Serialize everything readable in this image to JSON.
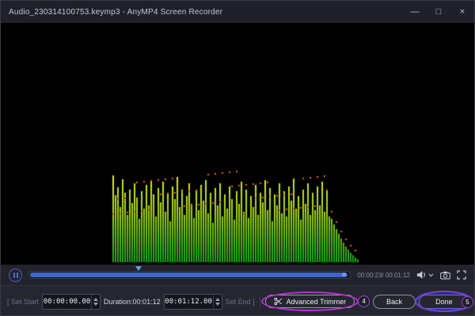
{
  "window": {
    "title": "Audio_230314100753.keymp3  -  AnyMP4 Screen Recorder",
    "controls": {
      "minimize": "—",
      "maximize": "□",
      "close": "×"
    }
  },
  "playback": {
    "time_display": "00:00:23/ 00:01:12",
    "progress_percent": 34,
    "fill_percent": 99
  },
  "toolbar": {
    "set_start_label": "[ Set Start",
    "start_time_value": "00:00:00.00",
    "duration_label": "Duration:00:01:12",
    "end_time_value": "00:01:12.00",
    "set_end_label": "Set End ]",
    "advanced_trimmer_label": "Advanced Trimmer",
    "back_label": "Back",
    "done_label": "Done"
  },
  "annotations": {
    "badge4": "4",
    "badge5": "5"
  },
  "colors": {
    "accent_blue": "#4263cf",
    "bar_green": "#17a317",
    "bar_mid": "#9ed414",
    "bar_yellow": "#f0f014",
    "peak_orange": "#e8680e",
    "annotation_magenta": "#bb2fd6",
    "annotation_purple": "#7b3de2"
  },
  "waveform": {
    "heights": [
      110,
      85,
      95,
      70,
      105,
      88,
      60,
      92,
      75,
      100,
      82,
      55,
      90,
      68,
      98,
      72,
      104,
      86,
      58,
      94,
      76,
      102,
      64,
      88,
      52,
      96,
      80,
      108,
      70,
      92,
      60,
      84,
      100,
      74,
      56,
      90,
      66,
      98,
      78,
      104,
      62,
      88,
      50,
      94,
      72,
      100,
      58,
      86,
      68,
      96,
      80,
      54,
      90,
      74,
      102,
      64,
      92,
      56,
      84,
      70,
      98,
      60,
      88,
      76,
      104,
      66,
      94,
      52,
      86,
      72,
      100,
      62,
      90,
      58,
      96,
      78,
      106,
      68,
      84,
      54,
      92,
      74,
      100,
      60,
      88,
      66,
      96,
      72,
      102,
      64,
      90,
      58,
      55,
      48,
      42,
      36,
      30,
      25,
      20,
      16,
      12,
      9,
      6,
      4
    ]
  }
}
